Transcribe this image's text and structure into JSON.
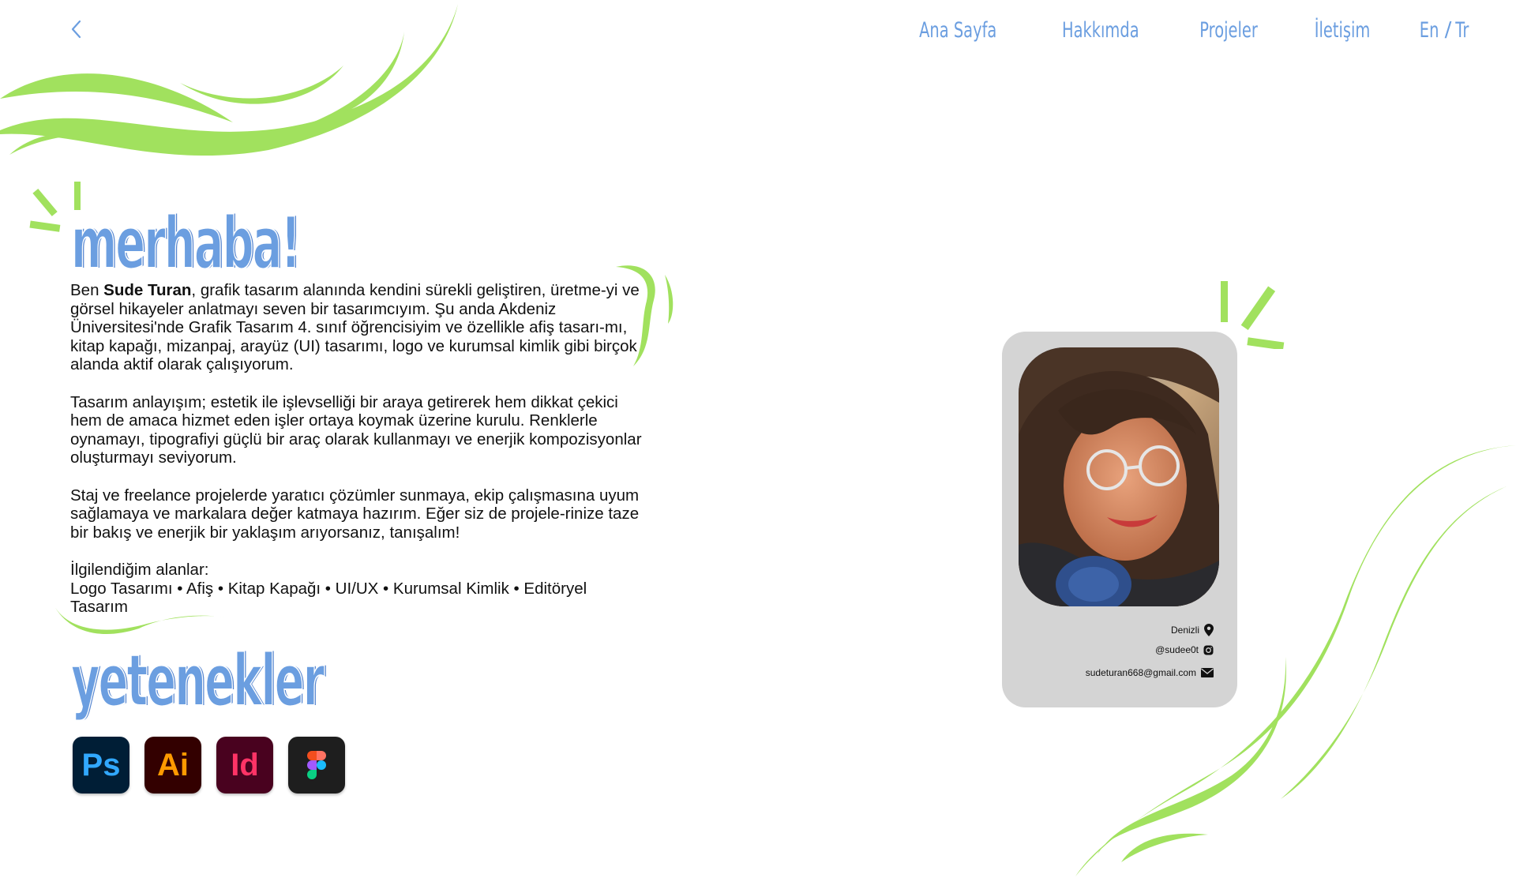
{
  "nav": {
    "items": [
      {
        "label": "Ana Sayfa"
      },
      {
        "label": "Hakkımda"
      },
      {
        "label": "Projeler"
      },
      {
        "label": "İletişim"
      }
    ],
    "lang_en": "En",
    "lang_sep": "/",
    "lang_tr": "Tr"
  },
  "hero": {
    "greeting": "merhaba!"
  },
  "about": {
    "p1_prefix": "Ben ",
    "name": "Sude Turan",
    "p1_rest": ", grafik tasarım alanında kendini sürekli geliştiren, üretme-yi ve görsel hikayeler anlatmayı seven bir tasarımcıyım. Şu anda  Akdeniz Üniversitesi'nde Grafik Tasarım 4. sınıf öğrencisiyim ve özellikle afiş tasarı-mı, kitap kapağı, mizanpaj, arayüz (UI) tasarımı, logo ve kurumsal kimlik gibi birçok alanda aktif olarak çalışıyorum.",
    "p2": "Tasarım anlayışım; estetik ile işlevselliği bir araya getirerek hem dikkat çekici hem de amaca hizmet eden işler ortaya koymak üzerine kurulu. Renklerle oynamayı, tipografiyi güçlü bir araç olarak kullanmayı ve enerjik kompozisyonlar oluşturmayı seviyorum.",
    "p3": "Staj ve freelance projelerde yaratıcı çözümler sunmaya, ekip çalışmasına uyum sağlamaya ve markalara değer katmaya hazırım. Eğer siz de projele-rinize taze bir bakış ve enerjik bir yaklaşım arıyorsanız, tanışalım!",
    "interests_title": "İlgilendiğim alanlar:",
    "interests": "Logo Tasarımı • Afiş • Kitap Kapağı • UI/UX • Kurumsal Kimlik • Editöryel Tasarım"
  },
  "skills": {
    "title": "yetenekler",
    "apps": [
      {
        "label": "Ps",
        "icon": "photoshop-icon",
        "bg": "#001e36",
        "fg": "#31a8ff"
      },
      {
        "label": "Ai",
        "icon": "illustrator-icon",
        "bg": "#330000",
        "fg": "#ff9a00"
      },
      {
        "label": "Id",
        "icon": "indesign-icon",
        "bg": "#49021f",
        "fg": "#ff3366"
      },
      {
        "label": "",
        "icon": "figma-icon",
        "bg": "#1e1e1e",
        "fg": "#ffffff"
      }
    ]
  },
  "contact": {
    "location": "Denizli",
    "instagram": "@sudee0t",
    "email": "sudeturan668@gmail.com"
  },
  "colors": {
    "accent_blue": "#6b9ee0",
    "accent_green": "#a1e15e",
    "card_bg": "#d4d4d4"
  }
}
